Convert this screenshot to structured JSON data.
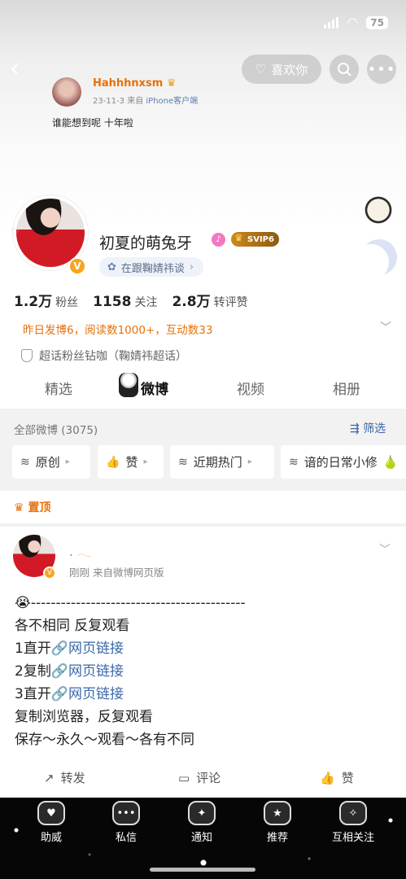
{
  "status": {
    "battery": "75"
  },
  "header": {
    "like_label": "喜欢你"
  },
  "bg_post": {
    "author": "Hahhhnxsm",
    "date": "23-11-3",
    "source_prefix": "来自",
    "source": "iPhone客户端",
    "text": "谁能想到呢 十年啦"
  },
  "profile": {
    "name": "初夏的萌兔牙",
    "vip": "SVIP6",
    "following_tag": "在跟鞠婧祎谈",
    "stats": [
      {
        "num": "1.2万",
        "label": "粉丝"
      },
      {
        "num": "1158",
        "label": "关注"
      },
      {
        "num": "2.8万",
        "label": "转评赞"
      }
    ],
    "activity": "昨日发博6，阅读数1000+，互动数33",
    "superfan": "超话粉丝钻咖（鞠婧祎超话）"
  },
  "tabs": [
    "精选",
    "微博",
    "视频",
    "相册"
  ],
  "filter": {
    "all": "全部微博 (3075)",
    "filter_label": "筛选",
    "chips": [
      "原创",
      "赞",
      "近期热门",
      "谙的日常小修"
    ]
  },
  "pinned": "置顶",
  "post": {
    "author": ". 𓂃",
    "meta": "刚刚  来自微博网页版",
    "emoji": "😭",
    "divider": "-------------------------------------------",
    "lines": [
      {
        "text": "各不相同  反复观看",
        "link": ""
      },
      {
        "text": "1直开",
        "link": "网页链接"
      },
      {
        "text": "2复制",
        "link": "网页链接"
      },
      {
        "text": "3直开",
        "link": "网页链接"
      },
      {
        "text": "复制浏览器，反复观看",
        "link": ""
      },
      {
        "text": "保存～永久～观看～各有不同",
        "link": ""
      }
    ],
    "actions": {
      "repost": "转发",
      "comment": "评论",
      "like": "赞"
    }
  },
  "nav": [
    "助威",
    "私信",
    "通知",
    "推荐",
    "互相关注"
  ],
  "colors": {
    "accent": "#e8710a",
    "link": "#3b67a7",
    "nav_bg": "#060606"
  }
}
